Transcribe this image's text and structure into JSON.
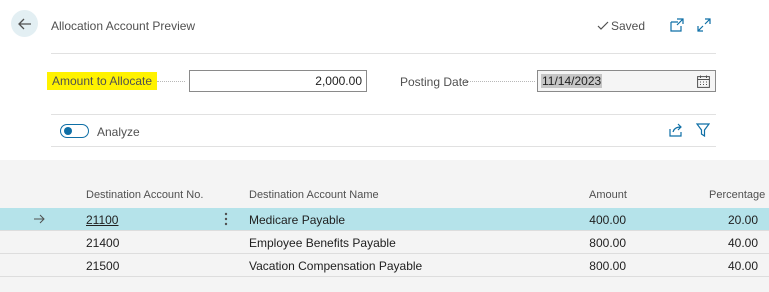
{
  "header": {
    "title": "Allocation Account Preview",
    "saved_label": "Saved"
  },
  "form": {
    "amount_label": "Amount to Allocate",
    "amount_value": "2,000.00",
    "posting_date_label": "Posting Date",
    "posting_date_value": "11/14/2023"
  },
  "toolbar": {
    "analyze_label": "Analyze",
    "analyze_on": false
  },
  "table": {
    "columns": [
      "Destination Account No.",
      "Destination Account Name",
      "Amount",
      "Percentage"
    ],
    "rows": [
      {
        "account_no": "21100",
        "account_name": "Medicare Payable",
        "amount": "400.00",
        "percentage": "20.00"
      },
      {
        "account_no": "21400",
        "account_name": "Employee Benefits Payable",
        "amount": "800.00",
        "percentage": "40.00"
      },
      {
        "account_no": "21500",
        "account_name": "Vacation Compensation Payable",
        "amount": "800.00",
        "percentage": "40.00"
      }
    ]
  },
  "colors": {
    "accent": "#0f6fa6",
    "highlight": "#fff200",
    "selected_row": "#b5e3ea"
  }
}
